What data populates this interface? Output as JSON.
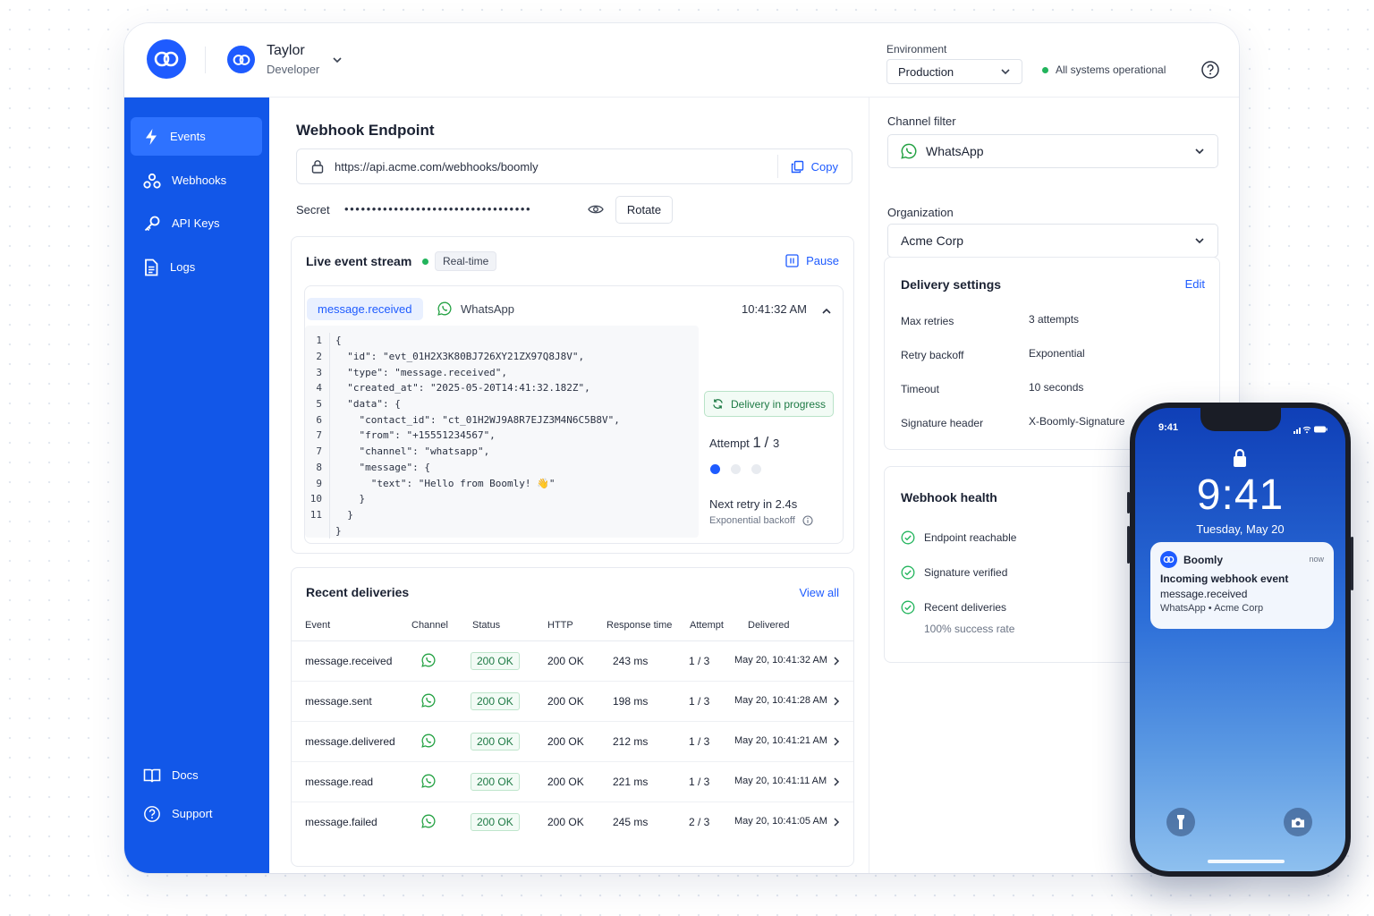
{
  "header": {
    "user": {
      "name": "Taylor",
      "role": "Developer"
    },
    "environment": {
      "label": "Environment",
      "value": "Production"
    },
    "status_text": "All systems operational"
  },
  "sidebar": {
    "items": [
      {
        "label": "Events",
        "icon": "bolt-icon",
        "active": true
      },
      {
        "label": "Webhooks",
        "icon": "webhook-icon"
      },
      {
        "label": "API Keys",
        "icon": "key-icon"
      },
      {
        "label": "Logs",
        "icon": "document-icon"
      }
    ],
    "bottom_items": [
      {
        "label": "Docs",
        "icon": "book-icon"
      },
      {
        "label": "Support",
        "icon": "help-circle-icon"
      }
    ]
  },
  "endpoint": {
    "title": "Webhook Endpoint",
    "url": "https://api.acme.com/webhooks/boomly",
    "copy_label": "Copy",
    "secret_label": "Secret",
    "secret_mask": "••••••••••••••••••••••••••••••••••",
    "rotate_label": "Rotate"
  },
  "stream": {
    "title": "Live event stream",
    "badge": "Real-time",
    "pause_label": "Pause",
    "event": {
      "type": "message.received",
      "channel": "WhatsApp",
      "time": "10:41:32 AM",
      "code_lines": [
        {
          "n": "1",
          "t": "{"
        },
        {
          "n": "2",
          "t": "  \"id\": \"evt_01H2X3K80BJ726XY21ZX97Q8J8V\","
        },
        {
          "n": "3",
          "t": "  \"type\": \"message.received\","
        },
        {
          "n": "4",
          "t": "  \"created_at\": \"2025-05-20T14:41:32.182Z\","
        },
        {
          "n": "5",
          "t": "  \"data\": {"
        },
        {
          "n": "6",
          "t": "    \"contact_id\": \"ct_01H2WJ9A8R7EJZ3M4N6C5B8V\","
        },
        {
          "n": "7",
          "t": "    \"from\": \"+15551234567\","
        },
        {
          "n": "7",
          "t": "    \"channel\": \"whatsapp\","
        },
        {
          "n": "8",
          "t": "    \"message\": {"
        },
        {
          "n": "9",
          "t": "      \"text\": \"Hello from Boomly! 👋\""
        },
        {
          "n": "10",
          "t": "    }"
        },
        {
          "n": "11",
          "t": "  }"
        },
        {
          "n": "",
          "t": "}"
        }
      ],
      "delivery_status": "Delivery in progress",
      "attempt_label": "Attempt",
      "attempt_current": "1",
      "attempt_total": "3",
      "next_retry": "Next retry in 2.4s",
      "backoff_label": "Exponential backoff"
    }
  },
  "deliveries": {
    "title": "Recent deliveries",
    "view_all": "View all",
    "columns": [
      "Event",
      "Channel",
      "Status",
      "HTTP",
      "Response time",
      "Attempt",
      "Delivered"
    ],
    "rows": [
      {
        "event": "message.received",
        "status": "200 OK",
        "http": "200 OK",
        "response": "243 ms",
        "attempt": "1 / 3",
        "delivered": "May 20, 10:41:32 AM"
      },
      {
        "event": "message.sent",
        "status": "200 OK",
        "http": "200 OK",
        "response": "198 ms",
        "attempt": "1 / 3",
        "delivered": "May 20, 10:41:28 AM"
      },
      {
        "event": "message.delivered",
        "status": "200 OK",
        "http": "200 OK",
        "response": "212 ms",
        "attempt": "1 / 3",
        "delivered": "May 20, 10:41:21 AM"
      },
      {
        "event": "message.read",
        "status": "200 OK",
        "http": "200 OK",
        "response": "221 ms",
        "attempt": "1 / 3",
        "delivered": "May 20, 10:41:11 AM"
      },
      {
        "event": "message.failed",
        "status": "200 OK",
        "http": "200 OK",
        "response": "245 ms",
        "attempt": "2 / 3",
        "delivered": "May 20, 10:41:05 AM"
      }
    ]
  },
  "filters": {
    "channel_label": "Channel filter",
    "channel_value": "WhatsApp",
    "org_label": "Organization",
    "org_value": "Acme Corp"
  },
  "delivery_settings": {
    "title": "Delivery settings",
    "edit_label": "Edit",
    "rows": [
      {
        "label": "Max retries",
        "value": "3 attempts"
      },
      {
        "label": "Retry backoff",
        "value": "Exponential"
      },
      {
        "label": "Timeout",
        "value": "10 seconds"
      },
      {
        "label": "Signature header",
        "value": "X-Boomly-Signature"
      }
    ]
  },
  "health": {
    "title": "Webhook health",
    "items": [
      "Endpoint reachable",
      "Signature verified",
      "Recent deliveries"
    ],
    "success_rate": "100% success rate"
  },
  "phone": {
    "status_time": "9:41",
    "clock": "9:41",
    "date": "Tuesday, May 20",
    "notification": {
      "app": "Boomly",
      "time": "now",
      "title": "Incoming webhook event",
      "event": "message.received",
      "meta": "WhatsApp • Acme Corp"
    }
  },
  "colors": {
    "brand": "#1e5bff",
    "sidebar": "#1257e8",
    "success": "#22b45c",
    "whatsapp": "#25a244"
  }
}
